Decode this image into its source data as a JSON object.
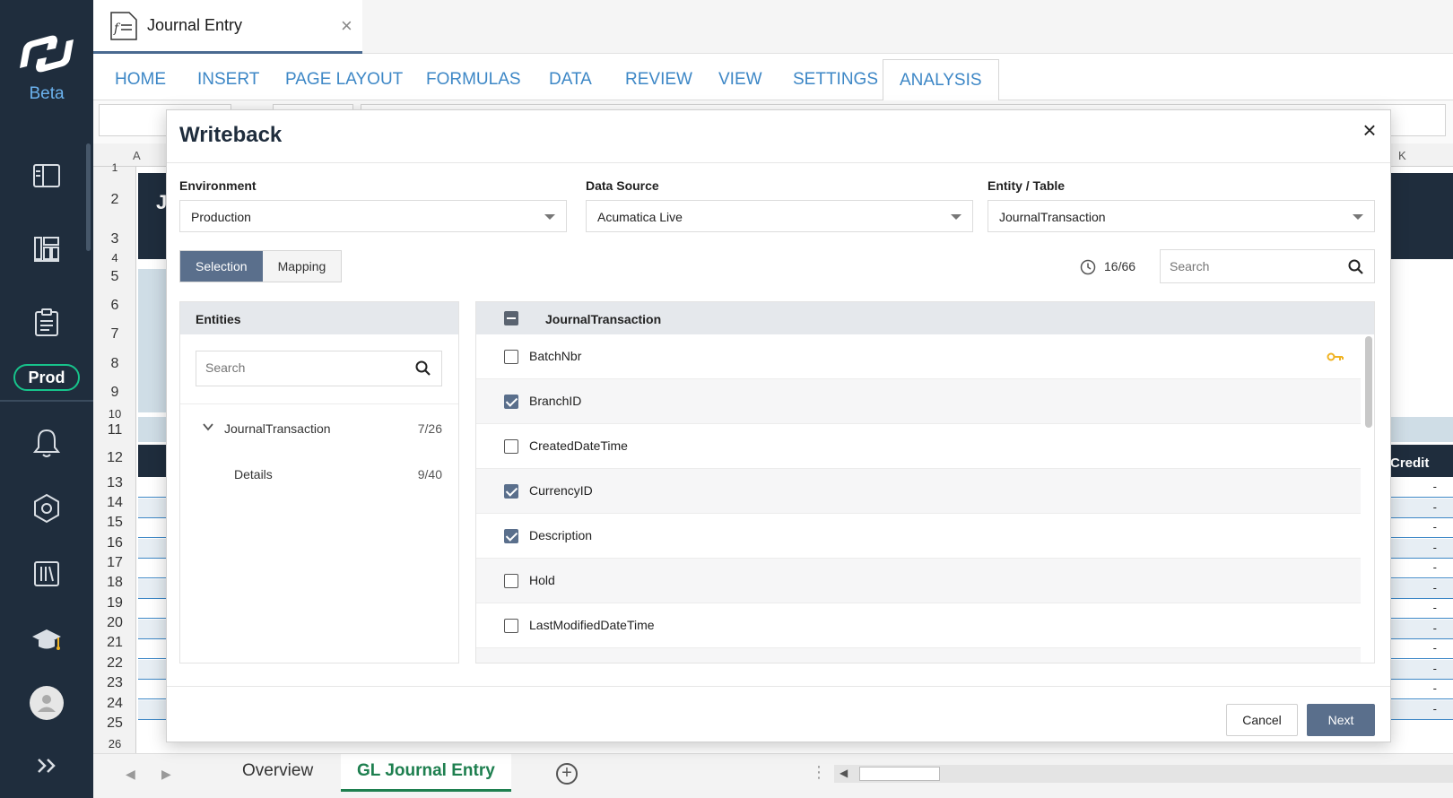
{
  "sidebar": {
    "brand_label": "Beta",
    "env_badge": "Prod",
    "icons": [
      "book-icon",
      "dashboard-icon",
      "clipboard-icon",
      "bell-icon",
      "hexagon-settings-icon",
      "library-icon",
      "graduation-cap-icon",
      "user-avatar-icon",
      "expand-icon"
    ]
  },
  "document_tab": {
    "title": "Journal Entry",
    "close": "×"
  },
  "ribbon": {
    "tabs": [
      "HOME",
      "INSERT",
      "PAGE LAYOUT",
      "FORMULAS",
      "DATA",
      "REVIEW",
      "VIEW",
      "SETTINGS",
      "ANALYSIS"
    ],
    "active_tab": "ANALYSIS"
  },
  "sheet": {
    "col_a": "A",
    "col_k": "K",
    "row_numbers": [
      "1",
      "2",
      "3",
      "4",
      "5",
      "6",
      "7",
      "8",
      "9",
      "10",
      "11",
      "12",
      "13",
      "14",
      "15",
      "16",
      "17",
      "18",
      "19",
      "20",
      "21",
      "22",
      "23",
      "24",
      "25",
      "26"
    ],
    "title_initial": "J",
    "credit_header": "Credit",
    "dash": "-",
    "tabs": [
      "Overview",
      "GL Journal Entry"
    ],
    "active_sheet": "GL Journal Entry"
  },
  "modal": {
    "title": "Writeback",
    "close": "×",
    "environment": {
      "label": "Environment",
      "value": "Production"
    },
    "data_source": {
      "label": "Data Source",
      "value": "Acumatica Live"
    },
    "entity_table": {
      "label": "Entity / Table",
      "value": "JournalTransaction"
    },
    "segments": [
      "Selection",
      "Mapping"
    ],
    "active_segment": "Selection",
    "counter": "16/66",
    "search_placeholder": "Search",
    "entities_panel": {
      "header": "Entities",
      "search_placeholder": "Search",
      "items": [
        {
          "name": "JournalTransaction",
          "count": "7/26"
        },
        {
          "name": "Details",
          "count": "9/40"
        }
      ]
    },
    "fields_panel": {
      "header": "JournalTransaction",
      "rows": [
        {
          "name": "BatchNbr",
          "checked": false,
          "key": true
        },
        {
          "name": "BranchID",
          "checked": true
        },
        {
          "name": "CreatedDateTime",
          "checked": false
        },
        {
          "name": "CurrencyID",
          "checked": true
        },
        {
          "name": "Description",
          "checked": true
        },
        {
          "name": "Hold",
          "checked": false
        },
        {
          "name": "LastModifiedDateTime",
          "checked": false
        }
      ]
    },
    "cancel_label": "Cancel",
    "next_label": "Next"
  },
  "colors": {
    "sidebar": "#1f2d3d",
    "accent": "#5a6f8c",
    "ribbon_text": "#3d87c6",
    "prod_border": "#17c38b",
    "sheet_active": "#1e7f4f",
    "key": "#f0b323"
  }
}
